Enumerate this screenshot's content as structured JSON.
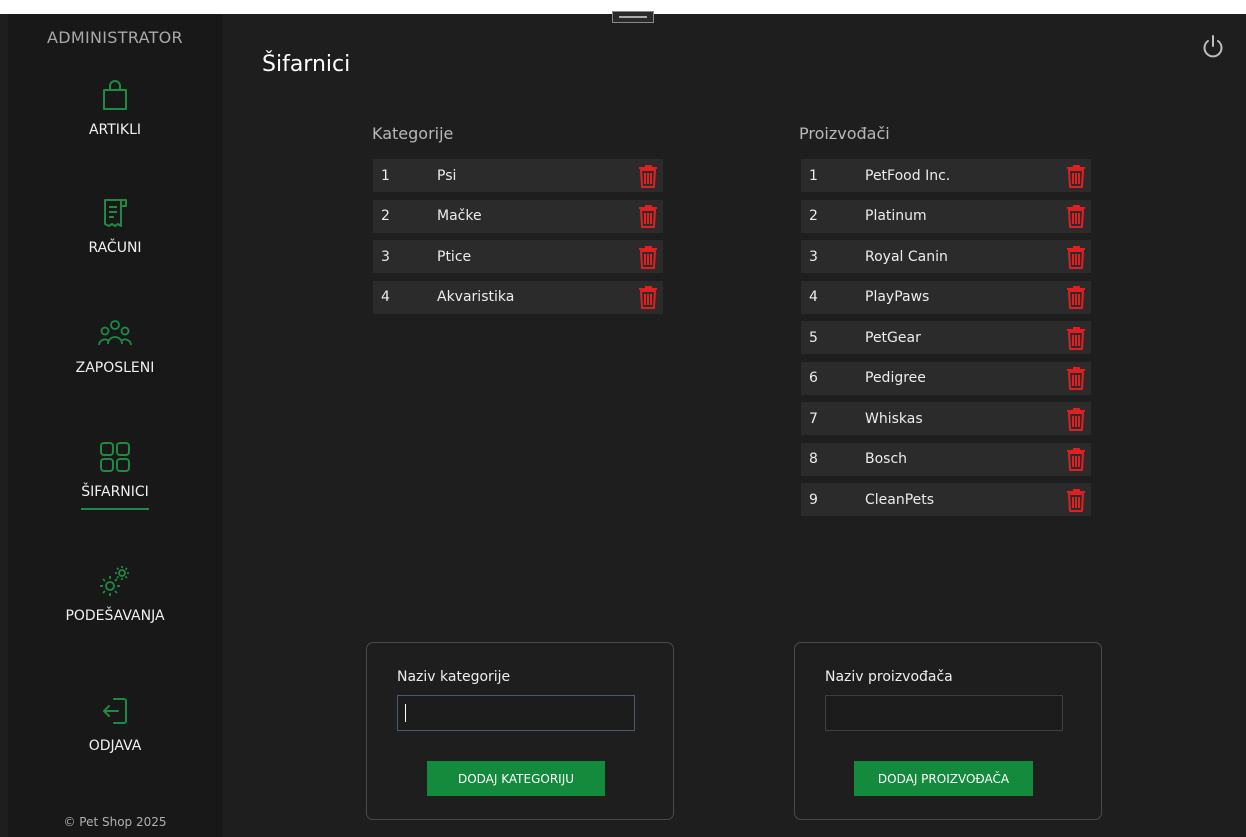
{
  "sidebar": {
    "role": "ADMINISTRATOR",
    "items": [
      {
        "label": "ARTIKLI",
        "icon": "shopping-bag-icon"
      },
      {
        "label": "RAČUNI",
        "icon": "receipt-icon"
      },
      {
        "label": "ZAPOSLENI",
        "icon": "users-icon"
      },
      {
        "label": "ŠIFARNICI",
        "icon": "grid-icon",
        "active": true
      },
      {
        "label": "PODEŠAVANJA",
        "icon": "gears-icon"
      },
      {
        "label": "ODJAVA",
        "icon": "logout-icon"
      }
    ],
    "copyright": "© Pet Shop 2025"
  },
  "page": {
    "title": "Šifarnici"
  },
  "colors": {
    "accent": "#1f8a44",
    "delete": "#e02020",
    "button": "#138a3c",
    "background": "#1e1e1e",
    "sidebar": "#181818",
    "row": "#2b2b2b"
  },
  "categories": {
    "title": "Kategorije",
    "rows": [
      {
        "id": "1",
        "name": "Psi"
      },
      {
        "id": "2",
        "name": "Mačke"
      },
      {
        "id": "3",
        "name": "Ptice"
      },
      {
        "id": "4",
        "name": "Akvaristika"
      }
    ],
    "form": {
      "label": "Naziv kategorije",
      "value": "",
      "button": "DODAJ KATEGORIJU"
    }
  },
  "manufacturers": {
    "title": "Proizvođači",
    "rows": [
      {
        "id": "1",
        "name": "PetFood Inc."
      },
      {
        "id": "2",
        "name": "Platinum"
      },
      {
        "id": "3",
        "name": "Royal Canin"
      },
      {
        "id": "4",
        "name": "PlayPaws"
      },
      {
        "id": "5",
        "name": "PetGear"
      },
      {
        "id": "6",
        "name": "Pedigree"
      },
      {
        "id": "7",
        "name": "Whiskas"
      },
      {
        "id": "8",
        "name": "Bosch"
      },
      {
        "id": "9",
        "name": "CleanPets"
      }
    ],
    "form": {
      "label": "Naziv proizvođača",
      "value": "",
      "button": "DODAJ PROIZVOĐAČA"
    }
  }
}
